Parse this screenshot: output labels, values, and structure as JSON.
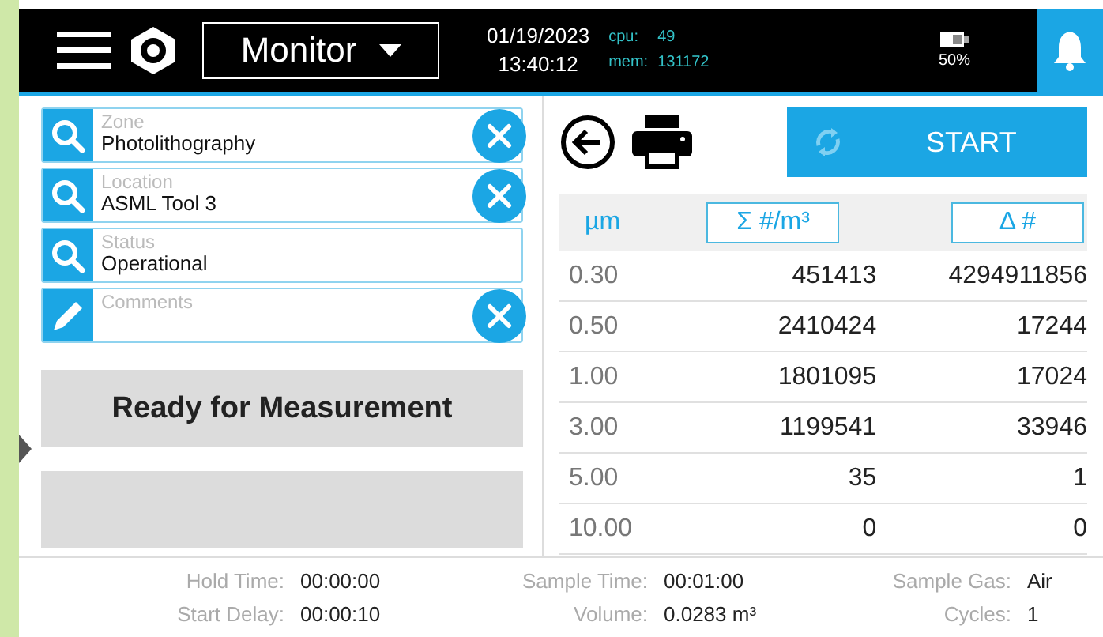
{
  "header": {
    "mode": "Monitor",
    "date": "01/19/2023",
    "time": "13:40:12",
    "cpu_label": "cpu:",
    "cpu": "49",
    "mem_label": "mem:",
    "mem": "131172",
    "battery": "50%"
  },
  "fields": [
    {
      "label": "Zone",
      "value": "Photolithography",
      "kind": "search",
      "clearable": true
    },
    {
      "label": "Location",
      "value": "ASML Tool 3",
      "kind": "search",
      "clearable": true
    },
    {
      "label": "Status",
      "value": "Operational",
      "kind": "search",
      "clearable": false
    },
    {
      "label": "Comments",
      "kind": "edit",
      "clearable": true
    }
  ],
  "status_button": "Ready for Measurement",
  "start_button": "START",
  "table": {
    "columns": [
      "µm",
      "Σ #/m³",
      "Δ #"
    ],
    "rows": [
      [
        "0.30",
        "451413",
        "4294911856"
      ],
      [
        "0.50",
        "2410424",
        "17244"
      ],
      [
        "1.00",
        "1801095",
        "17024"
      ],
      [
        "3.00",
        "1199541",
        "33946"
      ],
      [
        "5.00",
        "35",
        "1"
      ],
      [
        "10.00",
        "0",
        "0"
      ]
    ]
  },
  "footer": [
    {
      "label": "Hold Time:",
      "value": "00:00:00"
    },
    {
      "label": "Sample Time:",
      "value": "00:01:00"
    },
    {
      "label": "Sample Gas:",
      "value": "Air"
    },
    {
      "label": "Start Delay:",
      "value": "00:00:10"
    },
    {
      "label": "Volume:",
      "value": "0.0283 m³"
    },
    {
      "label": "Cycles:",
      "value": "1"
    }
  ]
}
